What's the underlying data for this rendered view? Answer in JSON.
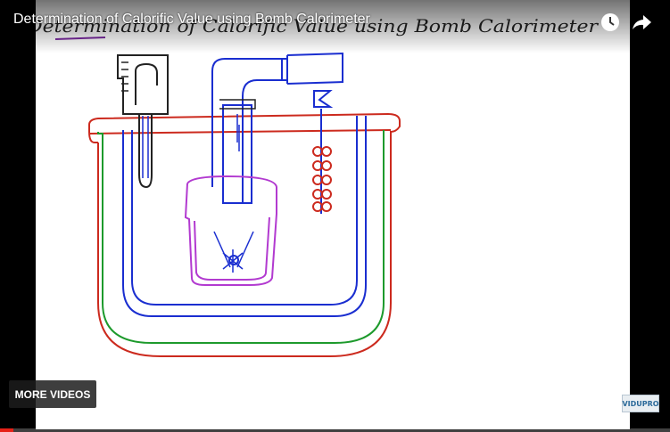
{
  "video": {
    "title": "Determination of Calorific Value using Bomb Calorimeter",
    "handwritten_title": "Determination of Calorific Value using Bomb Calorimeter",
    "played_fraction": 0.02
  },
  "controls": {
    "watch_later_icon": "clock-icon",
    "share_icon": "share-arrow-icon"
  },
  "more_videos": {
    "label": "MORE VIDEOS"
  },
  "watermark": {
    "text": "VIDUPRO"
  },
  "colors": {
    "outer_vessel": "#cc2a1e",
    "water_jacket": "#1d9a2c",
    "inner_vessel": "#1a2ed0",
    "crucible": "#b23ad0",
    "ink": "#1a1a1a",
    "progress": "#e62117"
  }
}
